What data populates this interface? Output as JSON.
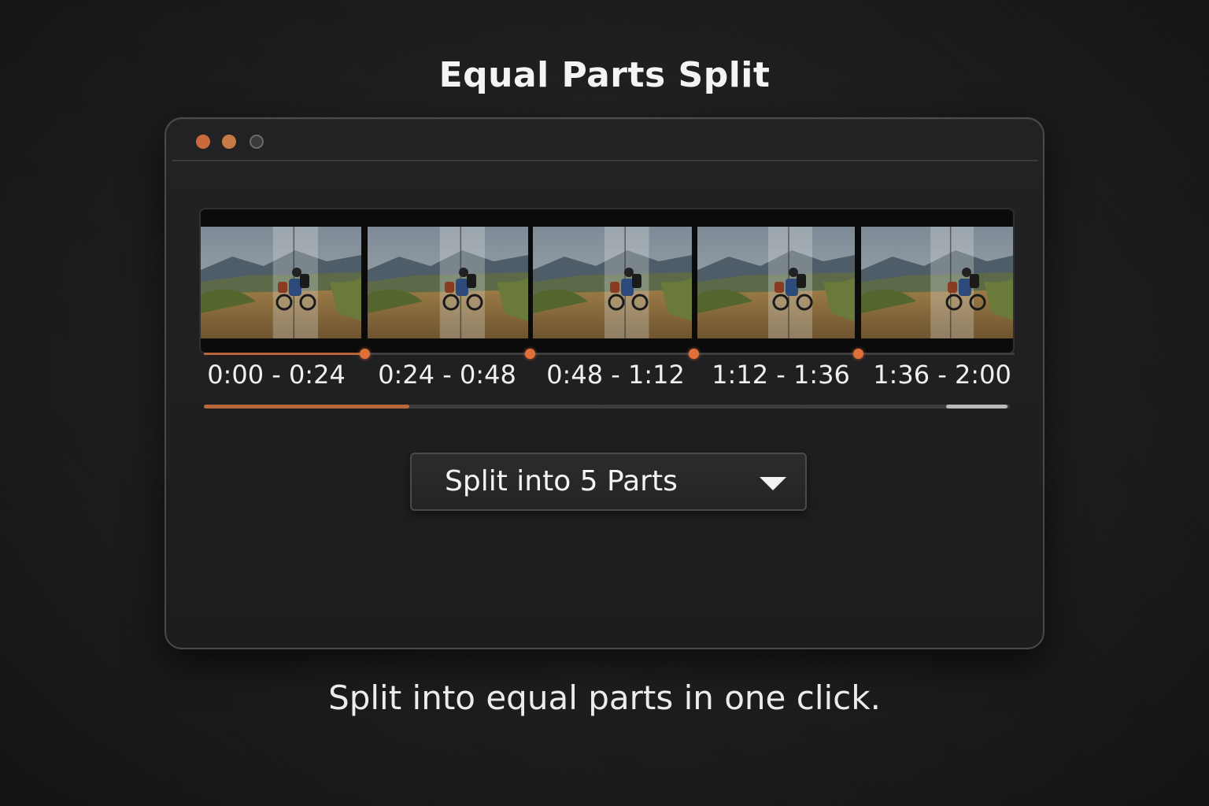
{
  "page": {
    "title": "Equal Parts Split",
    "caption": "Split into equal parts in one click."
  },
  "window": {
    "controls": [
      "close-dot",
      "minimize-dot",
      "zoom-dot"
    ]
  },
  "timeline": {
    "segments": [
      {
        "label": "0:00 - 0:24"
      },
      {
        "label": "0:24 - 0:48"
      },
      {
        "label": "0:48 - 1:12"
      },
      {
        "label": "1:12 - 1:36"
      },
      {
        "label": "1:36 - 2:00"
      }
    ],
    "progress_fraction": 0.255
  },
  "split_control": {
    "label": "Split into 5 Parts"
  },
  "colors": {
    "accent": "#e0703a",
    "background": "#1c1c1e",
    "window": "#1f1f21"
  }
}
